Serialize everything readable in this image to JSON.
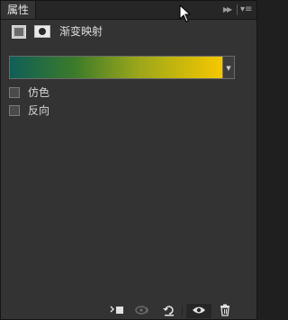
{
  "tabs": [
    {
      "label": "属性"
    }
  ],
  "panel": {
    "title": "渐变映射"
  },
  "gradient": {
    "colors": [
      "#0f5f57",
      "#3b7a2a",
      "#9aa61a",
      "#f6c700"
    ]
  },
  "options": [
    {
      "label": "仿色",
      "checked": false
    },
    {
      "label": "反向",
      "checked": false
    }
  ],
  "bottom_bar": {
    "visibility_on": true
  },
  "colors": {
    "panel_bg": "#333333",
    "tab_bar_bg": "#262626",
    "text": "#d6d6d6"
  }
}
